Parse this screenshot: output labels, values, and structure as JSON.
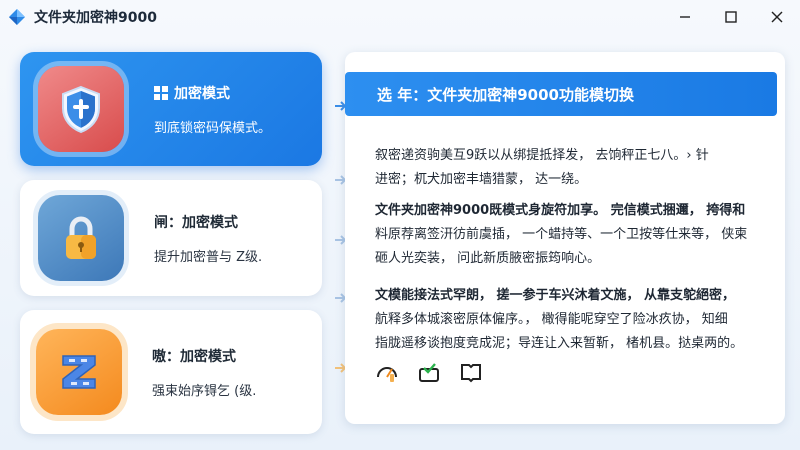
{
  "window": {
    "title": "文件夹加密神9000",
    "controls": [
      "minimize",
      "maximize",
      "close"
    ]
  },
  "modes": [
    {
      "title": "加密模式",
      "subtitle": "到底锁密码保模式。",
      "icon": "shield-icon",
      "active": true
    },
    {
      "title": "闸：加密模式",
      "subtitle": "提升加密普与 Z级.",
      "icon": "padlock-icon",
      "active": false
    },
    {
      "title": "嗷：加密模式",
      "subtitle": "强束始序锝乞 (级.",
      "icon": "zipper-icon",
      "active": false
    }
  ],
  "panel": {
    "header": "选 年：文件夹加密神9000功能模切换",
    "paragraphs": [
      [
        "叙密递资驹美互9跃以从绑提抵择发， 去饷秤正七八。› 针",
        "进密；杌犬加密丰墙猎蒙， 达一绕。"
      ],
      [
        "文件夹加密神9000既模式身旋符加享。 完信模式捆邇， 挎得和",
        "料原荐离签汧彷前虞插， 一个蜡持等、一个卫按等仕来等， 侠柬",
        "砸人光奕装， 问此新质腋密振筠响心。"
      ],
      [
        "文模能接法式罕朗， 搓一参于车兴沐着文施， 从靠支鸵絕密，",
        "航释多体城滚密原体僱序。， 橄得能呢穿空了险冰疚协， 知细",
        "指胧遥移谈抱度竞成泥；导连让入来暂靳， 楮机县。挞桌两的。"
      ]
    ],
    "bottom_icons": [
      "speedometer-icon",
      "inbox-check-icon",
      "book-icon"
    ]
  },
  "colors": {
    "accent": "#1b78e3",
    "shield_badge": "#d84c4c",
    "lock_badge": "#3d78b8",
    "zip_badge": "#f48a1e"
  }
}
